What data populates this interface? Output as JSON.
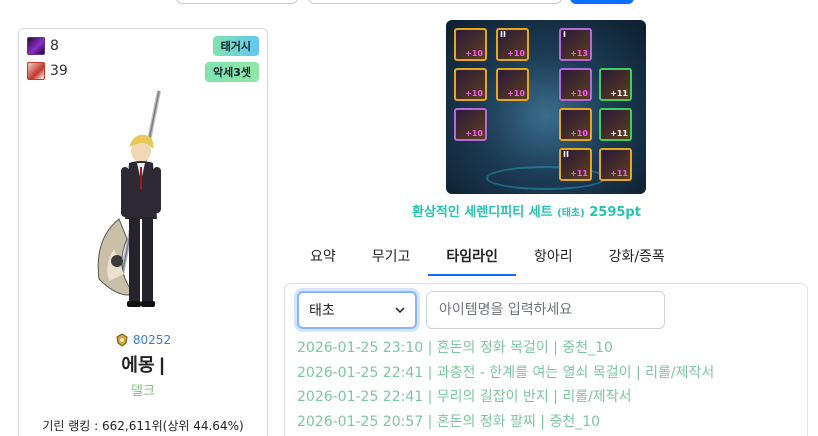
{
  "character": {
    "stat1_value": "8",
    "stat2_value": "39",
    "badge1": "태거시",
    "badge2": "악세3셋",
    "guild_number": "80252",
    "name": "에몽 |",
    "class": "델크",
    "rank_line": "기린 랭킹 : 662,611위(상위 44.64%)"
  },
  "equipment": {
    "slots": [
      {
        "lvl": "+10",
        "tier": "",
        "color": "gold"
      },
      {
        "lvl": "+10",
        "tier": "II",
        "color": "gold"
      },
      {
        "lvl": "+13",
        "tier": "I",
        "color": "purple"
      },
      {
        "lvl": "+10",
        "tier": "",
        "color": "gold"
      },
      {
        "lvl": "+10",
        "tier": "",
        "color": "gold"
      },
      {
        "lvl": "+10",
        "tier": "",
        "color": "purple"
      },
      {
        "lvl": "+11",
        "tier": "",
        "color": "green"
      },
      {
        "lvl": "+10",
        "tier": "",
        "color": "purple"
      },
      {
        "lvl": "+10",
        "tier": "",
        "color": "gold"
      },
      {
        "lvl": "+11",
        "tier": "",
        "color": "green"
      },
      {
        "lvl": "+11",
        "tier": "II",
        "color": "gold"
      },
      {
        "lvl": "+11",
        "tier": "",
        "color": "gold"
      }
    ],
    "set_name": "환상적인 세렌디피티 세트",
    "set_grade": "(태초)",
    "set_points": "2595pt"
  },
  "tabs": [
    "요약",
    "무기고",
    "타임라인",
    "항아리",
    "강화/증폭"
  ],
  "active_tab": "타임라인",
  "timeline": {
    "select_value": "태초",
    "search_placeholder": "아이템명을 입력하세요",
    "entries": [
      "2026-01-25 23:10 | 혼돈의 정화 목걸이 | 중천_10",
      "2026-01-25 22:41 | 과충전 - 한계를 여는 열쇠 목걸이 | 리롤/제작서",
      "2026-01-25 22:41 | 무리의 길잡이 반지 | 리롤/제작서",
      "2026-01-25 20:57 | 혼돈의 정화 팔찌 | 중천_10"
    ]
  },
  "colors": {
    "accent": "#0d6efd",
    "timeline_text": "#7cc79e",
    "set_title": "#27c3b0",
    "class_text": "#7bc67a"
  }
}
